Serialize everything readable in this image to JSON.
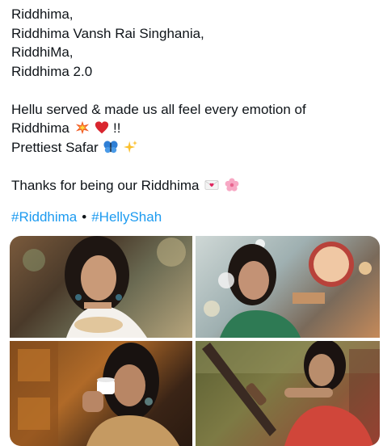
{
  "tweet": {
    "lines": [
      "Riddhima,",
      "Riddhima Vansh Rai Singhania,",
      "RiddhiMa,",
      "Riddhima 2.0",
      "Hellu served & made us all feel every  emotion of",
      "Riddhima",
      "!!",
      "Prettiest Safar",
      "Thanks for being our Riddhima"
    ],
    "emojis": [
      "collision-emoji",
      "red-heart-emoji",
      "butterfly-emoji",
      "sparkles-emoji",
      "love-letter-emoji",
      "cherry-blossom-emoji"
    ],
    "hashtags": [
      "#Riddhima",
      "#HellyShah"
    ],
    "separator": "•"
  },
  "colors": {
    "link": "#1d9bf0",
    "text": "#0f1419"
  }
}
